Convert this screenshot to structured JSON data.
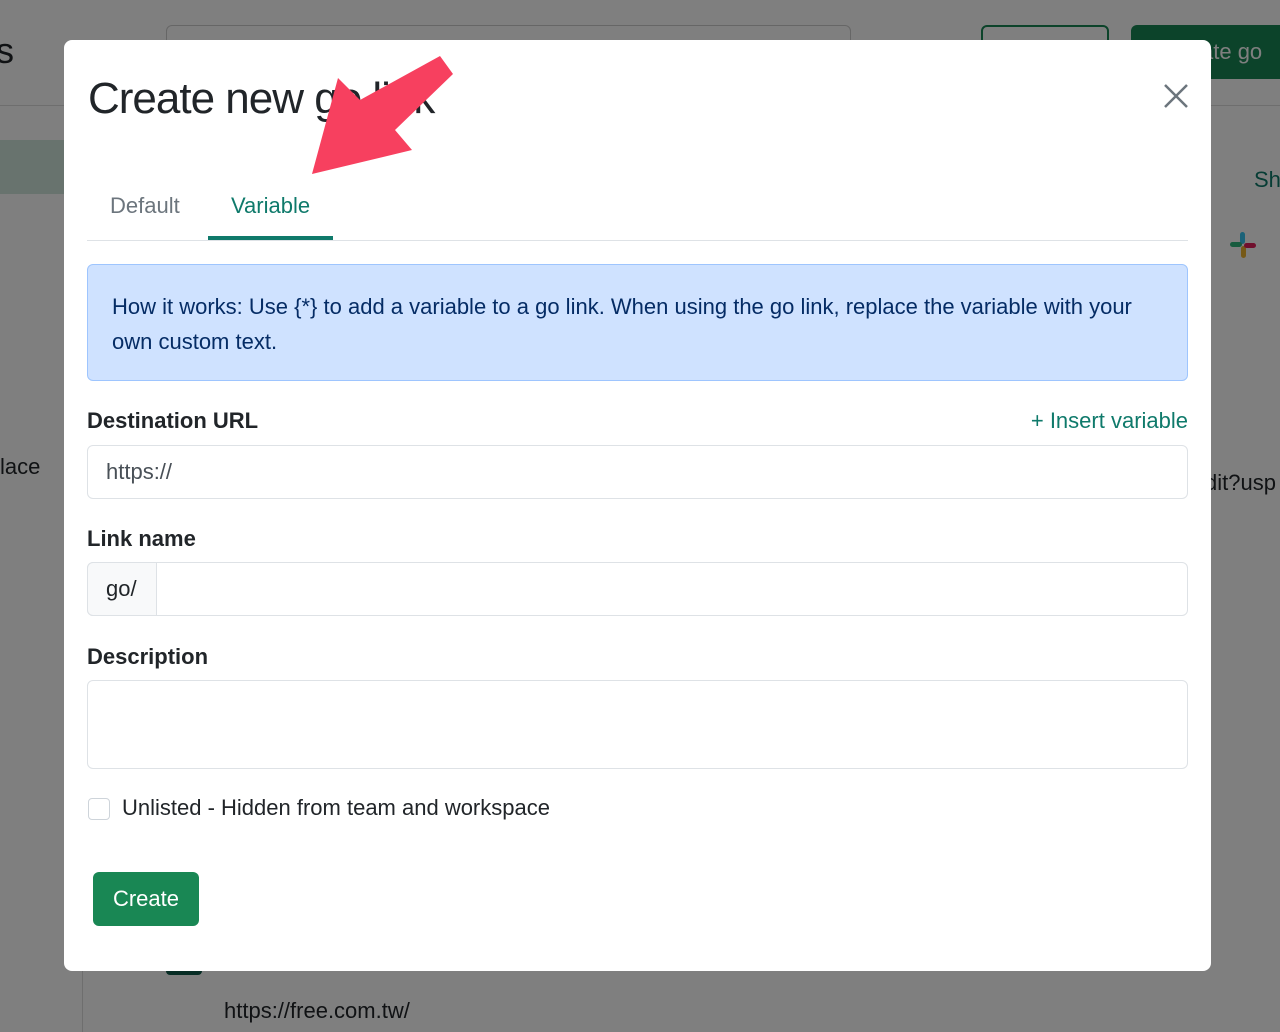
{
  "background": {
    "heading_fragment": "s",
    "create_button_fragment": "ate go",
    "column_fragment": "Sh",
    "sidebar_fragment": "lace",
    "url_fragment": "dit?usp",
    "row_url": "https://free.com.tw/"
  },
  "modal": {
    "title": "Create new go link",
    "close_icon": "close-icon",
    "tabs": [
      {
        "label": "Default",
        "active": false
      },
      {
        "label": "Variable",
        "active": true
      }
    ],
    "info_text": "How it works: Use {*} to add a variable to a go link. When using the go link, replace the variable with your own custom text.",
    "destination_label": "Destination URL",
    "insert_variable": "+ Insert variable",
    "destination_value": "https://",
    "link_name_label": "Link name",
    "link_prefix": "go/",
    "link_name_value": "",
    "description_label": "Description",
    "description_value": "",
    "unlisted_label": "Unlisted - Hidden from team and workspace",
    "unlisted_checked": false,
    "create_label": "Create"
  },
  "colors": {
    "accent": "#0f7a6b",
    "primary_button": "#198754",
    "info_bg": "#cfe2ff",
    "annotation_arrow": "#f7405f"
  }
}
